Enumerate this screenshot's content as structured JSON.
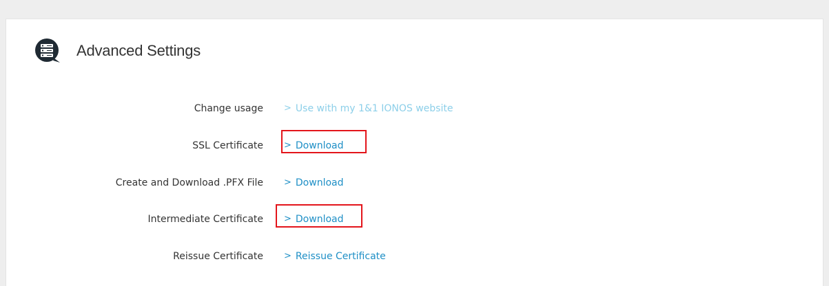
{
  "panel": {
    "title": "Advanced Settings",
    "icon": "server-icon"
  },
  "settings": [
    {
      "label": "Change usage",
      "link_text": "Use with my 1&1 IONOS website",
      "muted": true,
      "highlighted": false
    },
    {
      "label": "SSL Certificate",
      "link_text": "Download",
      "muted": false,
      "highlighted": true
    },
    {
      "label": "Create and Download .PFX File",
      "link_text": "Download",
      "muted": false,
      "highlighted": false
    },
    {
      "label": "Intermediate Certificate",
      "link_text": "Download",
      "muted": false,
      "highlighted": true
    },
    {
      "label": "Reissue Certificate",
      "link_text": "Reissue Certificate",
      "muted": false,
      "highlighted": false
    }
  ],
  "colors": {
    "link": "#1e8fc6",
    "link_muted": "#8ccfe9",
    "highlight": "#e3141a",
    "icon_bg": "#1f2a33"
  }
}
